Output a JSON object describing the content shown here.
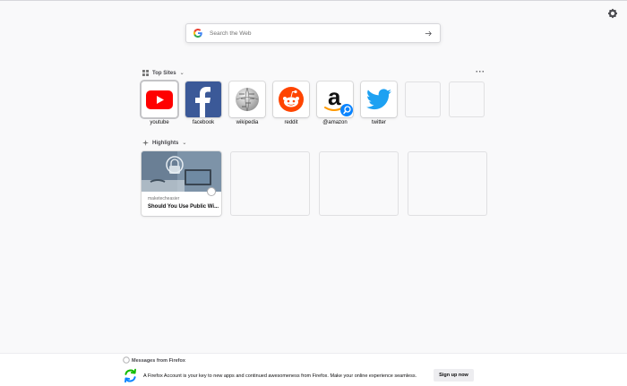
{
  "search": {
    "placeholder": "Search the Web"
  },
  "top_sites": {
    "title": "Top Sites",
    "tiles": [
      {
        "label": "youtube",
        "icon": "youtube-icon"
      },
      {
        "label": "facebook",
        "icon": "facebook-icon"
      },
      {
        "label": "wikipedia",
        "icon": "wikipedia-icon"
      },
      {
        "label": "reddit",
        "icon": "reddit-icon"
      },
      {
        "label": "@amazon",
        "icon": "amazon-icon"
      },
      {
        "label": "twitter",
        "icon": "twitter-icon"
      }
    ]
  },
  "highlights": {
    "title": "Highlights",
    "cards": [
      {
        "source": "maketecheasier",
        "title": "Should You Use Public Wi..."
      }
    ]
  },
  "footer": {
    "heading": "Messages from Firefox",
    "message": "A Firefox Account is your key to new apps and continued awesomeness from Firefox. Make your online experience seamless.",
    "button": "Sign up now"
  },
  "colors": {
    "background": "#f9f9fa",
    "youtube": "#ff0000",
    "facebook": "#3b5998",
    "reddit": "#ff4500",
    "twitter": "#1da1f2",
    "amazon_search_badge": "#0a84ff",
    "sync": "#12bc00"
  }
}
